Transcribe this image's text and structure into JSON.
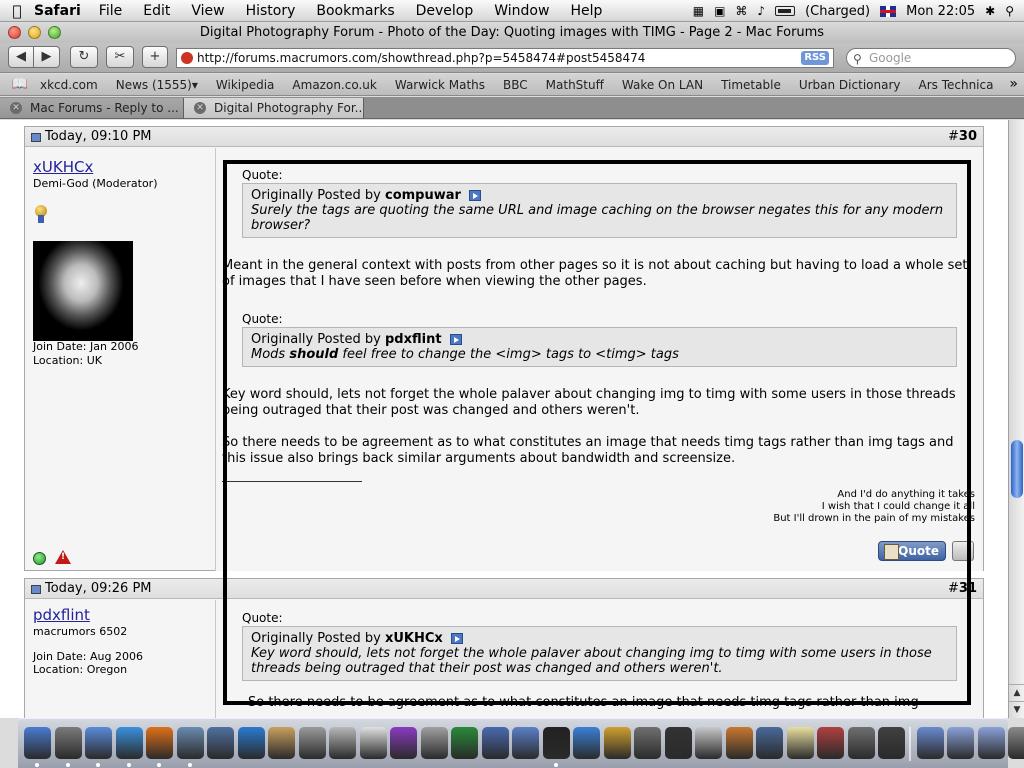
{
  "menubar": {
    "apple_glyph": "",
    "app_name": "Safari",
    "items": [
      "File",
      "Edit",
      "View",
      "History",
      "Bookmarks",
      "Develop",
      "Window",
      "Help"
    ],
    "battery_status": "(Charged)",
    "clock": "Mon 22:05"
  },
  "window": {
    "title": "Digital Photography Forum - Photo of the Day: Quoting images with TIMG - Page 2 - Mac Forums",
    "address": "http://forums.macrumors.com/showthread.php?p=5458474#post5458474",
    "rss_label": "RSS",
    "search_placeholder": "Google"
  },
  "bookmarks": [
    "xkcd.com",
    "News (1555)▾",
    "Wikipedia",
    "Amazon.co.uk",
    "Warwick Maths",
    "BBC",
    "MathStuff",
    "Wake On LAN",
    "Timetable",
    "Urban Dictionary",
    "Ars Technica"
  ],
  "tabs": [
    {
      "label": "Mac Forums - Reply to ...",
      "active": false
    },
    {
      "label": "Digital Photography For...",
      "active": true
    }
  ],
  "posts": [
    {
      "date": "Today, 09:10 PM",
      "number_prefix": "#",
      "number": "30",
      "username": "xUKHCx",
      "rank": "Demi-God (Moderator)",
      "join_date": "Join Date: Jan 2006",
      "location": "Location: UK",
      "quote_label_1": "Quote:",
      "quote1_prefix": "Originally Posted by",
      "quote1_author": "compuwar",
      "quote1_text": "Surely the tags are quoting the same URL and image caching on the browser negates this for any modern browser?",
      "para1": "Meant in the general context with posts from other pages so it is not about caching but having to load a whole set of images that I have seen before when viewing the other pages.",
      "quote_label_2": "Quote:",
      "quote2_prefix": "Originally Posted by",
      "quote2_author": "pdxflint",
      "quote2_text_a": "Mods ",
      "quote2_text_bold": "should",
      "quote2_text_b": " feel free to change the <img> tags to <timg> tags",
      "para2": "Key word should, lets not forget the whole palaver about changing img to timg with some users in those threads being outraged that their post was changed and others weren't.",
      "para3": "So there needs to be agreement as to what constitutes an image that needs timg tags rather than img tags and this issue also brings back similar arguments about bandwidth and screensize.",
      "sig": [
        "And I'd do anything it takes",
        "I wish that I could change it all",
        "But I'll drown in the pain of my mistakes"
      ],
      "quote_button": "Quote"
    },
    {
      "date": "Today, 09:26 PM",
      "number_prefix": "#",
      "number": "31",
      "username": "pdxflint",
      "rank": "macrumors 6502",
      "join_date": "Join Date: Aug 2006",
      "location": "Location: Oregon",
      "quote_label_1": "Quote:",
      "quote1_prefix": "Originally Posted by",
      "quote1_author": "xUKHCx",
      "quote1_text": "Key word should, lets not forget the whole palaver about changing img to timg with some users in those threads being outraged that their post was changed and others weren't.",
      "para1": "So there needs to be agreement as to what constitutes an image that needs timg tags rather than img"
    }
  ],
  "dock": {
    "icons": [
      "finder-icon",
      "dashboard-icon",
      "preview-icon",
      "safari-icon",
      "firefox-icon",
      "mail-icon",
      "iphoto-icon",
      "itunes-icon",
      "address-book-icon",
      "quicktime-icon",
      "latex-icon",
      "ical-icon",
      "itunes-purple-icon",
      "sync-icon",
      "grapher-icon",
      "xcode-icon",
      "chart-icon",
      "terminal-icon",
      "textedit-icon",
      "pages-icon",
      "books-icon",
      "console-icon",
      "text-icon",
      "dictionary-icon",
      "network-icon",
      "sticky-icon",
      "stuffit-icon",
      "crop-icon",
      "lock-icon"
    ],
    "right_icons": [
      "applications-folder-icon",
      "documents-folder-icon",
      "downloads-folder-icon",
      "trash-icon"
    ],
    "colors": {
      "finder": "#4a7ad0",
      "safari": "#3a90e0",
      "firefox": "#e07018",
      "terminal": "#222222",
      "trash": "#8a8a8a"
    }
  },
  "colors": {
    "username_link": "#22229c",
    "post_bg": "#f5f5f5",
    "quote_bg": "#e6e6e6",
    "scroll_thumb": "#2b63c8"
  }
}
